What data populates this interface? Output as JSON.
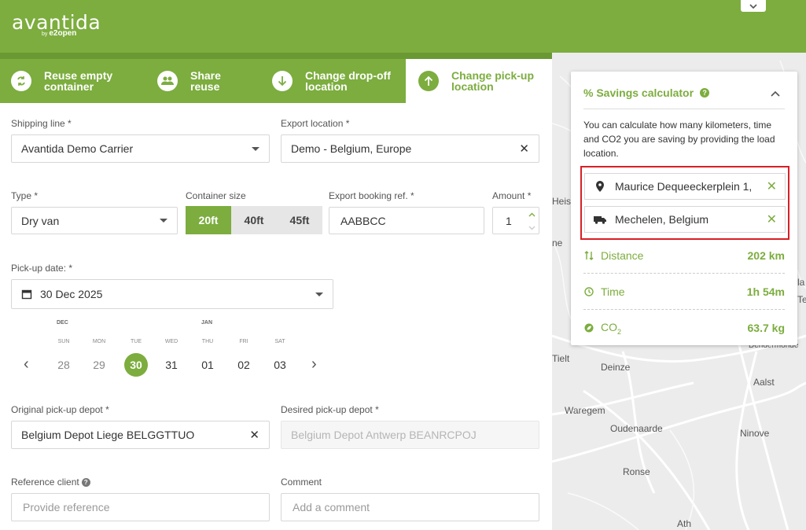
{
  "brand": {
    "logo": "avantida",
    "by": "by",
    "company": "e2open"
  },
  "tabs": [
    {
      "label": "Reuse empty container",
      "icon": "reuse-icon"
    },
    {
      "label": "Share reuse",
      "icon": "people-icon"
    },
    {
      "label": "Change drop-off location",
      "icon": "arrow-down-icon"
    },
    {
      "label": "Change pick-up location",
      "icon": "arrow-up-icon"
    }
  ],
  "form": {
    "shipping_line": {
      "label": "Shipping line *",
      "value": "Avantida Demo Carrier"
    },
    "export_location": {
      "label": "Export location *",
      "value": "Demo - Belgium, Europe"
    },
    "type": {
      "label": "Type *",
      "value": "Dry van"
    },
    "container_size": {
      "label": "Container size",
      "options": [
        "20ft",
        "40ft",
        "45ft"
      ],
      "selected": "20ft"
    },
    "export_booking_ref": {
      "label": "Export booking ref. *",
      "value": "AABBCC"
    },
    "amount": {
      "label": "Amount *",
      "value": "1"
    },
    "pickup_date": {
      "label": "Pick-up date: *",
      "value": "30 Dec 2025"
    },
    "original_depot": {
      "label": "Original pick-up depot *",
      "value": "Belgium Depot Liege BELGGTTUO"
    },
    "desired_depot": {
      "label": "Desired pick-up depot *",
      "value": "Belgium Depot Antwerp BEANRCPOJ"
    },
    "reference_client": {
      "label": "Reference client",
      "placeholder": "Provide reference"
    },
    "comment": {
      "label": "Comment",
      "placeholder": "Add a comment"
    }
  },
  "calendar": {
    "months": [
      "DEC",
      "JAN"
    ],
    "days": [
      {
        "dow": "SUN",
        "day": "28",
        "state": "past"
      },
      {
        "dow": "MON",
        "day": "29",
        "state": "past"
      },
      {
        "dow": "TUE",
        "day": "30",
        "state": "selected"
      },
      {
        "dow": "WED",
        "day": "31",
        "state": "normal"
      },
      {
        "dow": "THU",
        "day": "01",
        "state": "normal"
      },
      {
        "dow": "FRI",
        "day": "02",
        "state": "normal"
      },
      {
        "dow": "SAT",
        "day": "03",
        "state": "normal"
      }
    ]
  },
  "savings": {
    "title": "% Savings calculator",
    "description": "You can calculate how many kilometers, time and CO2 you are saving by providing the load location.",
    "origin": "Maurice Dequeeckerplein 1,",
    "destination": "Mechelen, Belgium",
    "distance": {
      "label": "Distance",
      "value": "202 km"
    },
    "time": {
      "label": "Time",
      "value": "1h 54m"
    },
    "co2": {
      "label": "CO",
      "sub": "2",
      "value": "63.7 kg"
    }
  },
  "map_labels": [
    "Heis",
    "ne",
    "Tielt",
    "Deinze",
    "Aalst",
    "Waregem",
    "Oudenaarde",
    "Ninove",
    "Ronse",
    "Ath",
    "Dendermonde",
    "la",
    "Te"
  ],
  "colors": {
    "brand": "#7cad3e",
    "highlight": "#d81f26"
  }
}
